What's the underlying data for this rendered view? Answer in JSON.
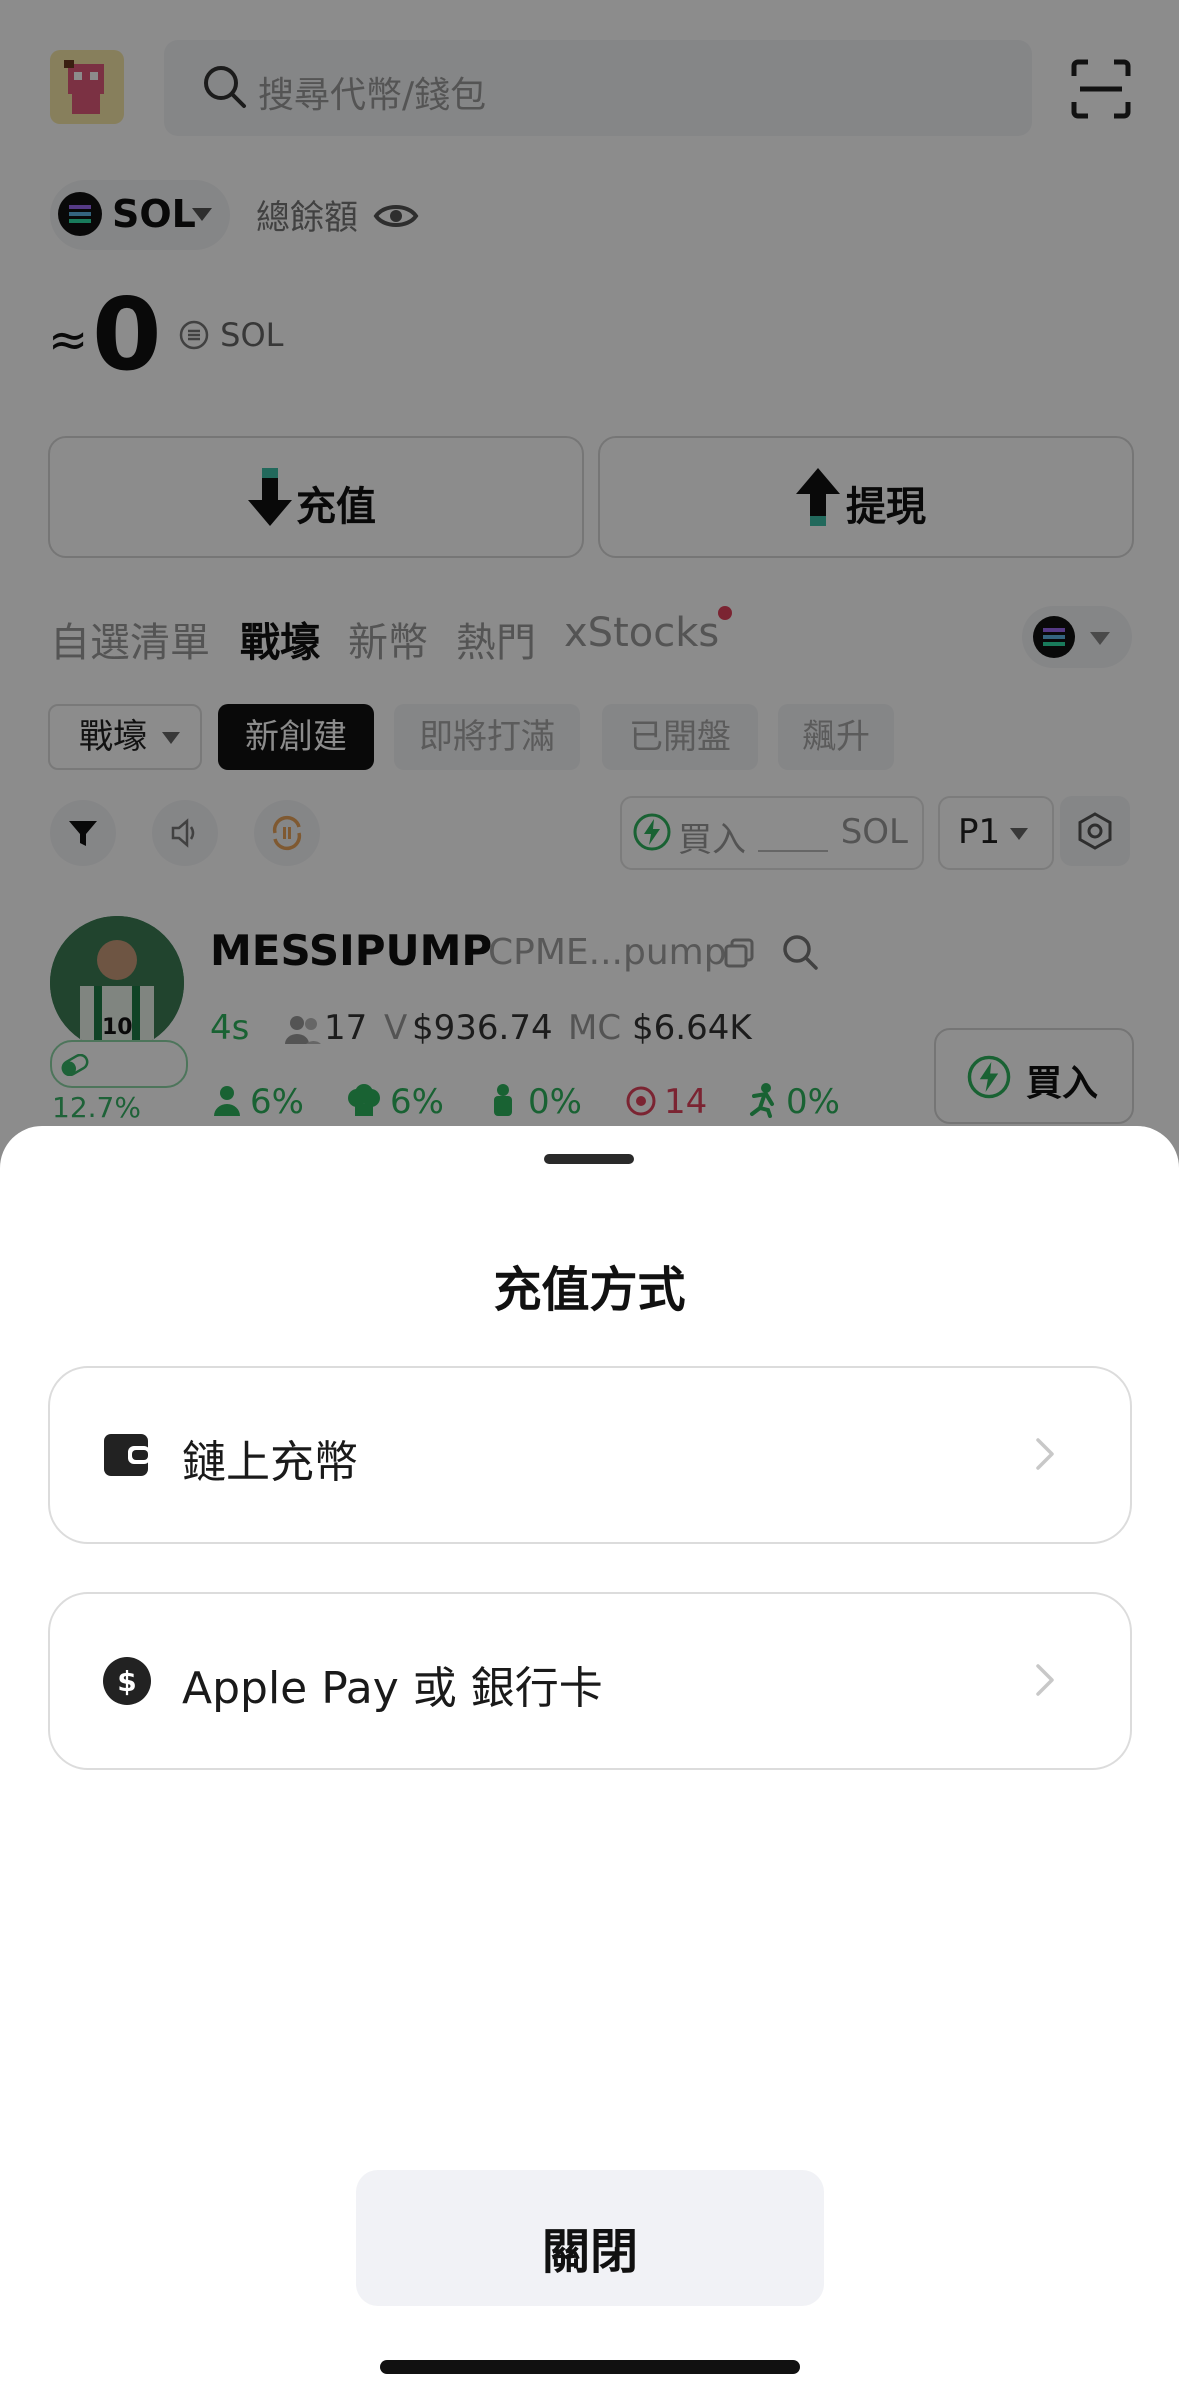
{
  "header": {
    "search_placeholder": "搜尋代幣/錢包"
  },
  "balance": {
    "chain": "SOL",
    "label": "總餘額",
    "approx": "≈",
    "value": "0",
    "unit": "SOL"
  },
  "actions": {
    "deposit": "充值",
    "withdraw": "提現"
  },
  "tabs": [
    "自選清單",
    "戰壕",
    "新幣",
    "熱門",
    "xStocks"
  ],
  "filters": {
    "dropdown": "戰壕",
    "chips": [
      "新創建",
      "即將打滿",
      "已開盤",
      "飆升"
    ]
  },
  "toolbar": {
    "buy_label": "買入",
    "buy_unit": "SOL",
    "page": "P1"
  },
  "token": {
    "name": "MESSIPUMP",
    "address": "CPME...pump",
    "age": "4s",
    "holders": "17",
    "volume_prefix": "V",
    "volume": "$936.74",
    "mc_prefix": "MC",
    "mc": "$6.64K",
    "progress": "12.7%",
    "stat1": "6%",
    "stat2": "6%",
    "stat3": "0%",
    "stat4": "14",
    "stat5": "0%",
    "buy": "買入"
  },
  "sheet": {
    "title": "充值方式",
    "options": [
      {
        "label": "鏈上充幣",
        "icon": "wallet-icon"
      },
      {
        "label": "Apple Pay 或 銀行卡",
        "icon": "dollar-coin-icon"
      }
    ],
    "close": "關閉"
  },
  "colors": {
    "accent_green": "#2fb25e",
    "accent_red": "#e0435b",
    "overlay": "rgba(0,0,0,0.45)"
  }
}
